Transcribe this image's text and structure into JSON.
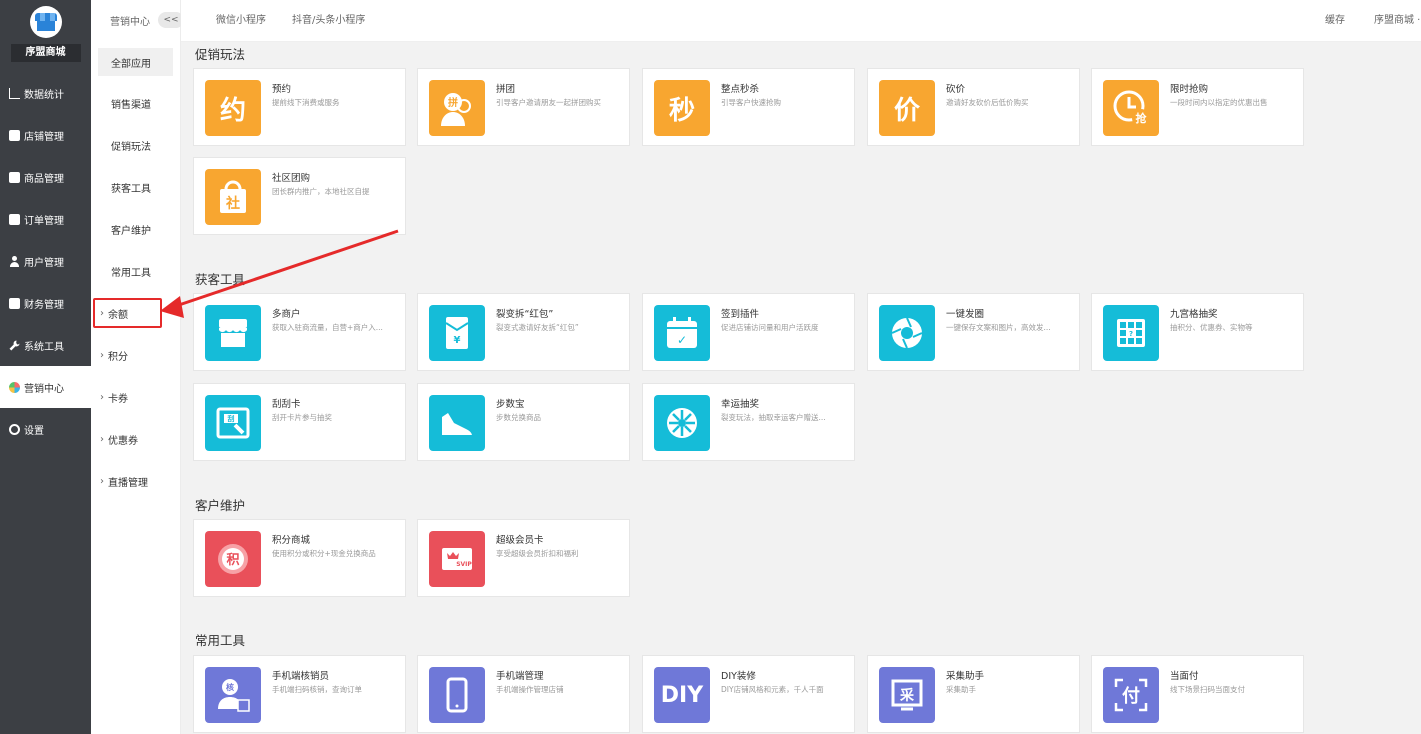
{
  "sidebar": {
    "store_name": "序盟商城",
    "items": [
      {
        "label": "数据统计",
        "icon": "chart-icon"
      },
      {
        "label": "店铺管理",
        "icon": "store-icon"
      },
      {
        "label": "商品管理",
        "icon": "goods-icon"
      },
      {
        "label": "订单管理",
        "icon": "order-icon"
      },
      {
        "label": "用户管理",
        "icon": "user-icon"
      },
      {
        "label": "财务管理",
        "icon": "finance-icon"
      },
      {
        "label": "系统工具",
        "icon": "wrench-icon"
      },
      {
        "label": "营销中心",
        "icon": "pinwheel-icon"
      },
      {
        "label": "设置",
        "icon": "gear-icon"
      }
    ]
  },
  "subside": {
    "title": "营销中心",
    "collapse_label": "<<",
    "items": [
      "全部应用",
      "销售渠道",
      "促销玩法",
      "获客工具",
      "客户维护",
      "常用工具"
    ],
    "expandable": [
      "余额",
      "积分",
      "卡券",
      "优惠券",
      "直播管理"
    ]
  },
  "topbar": {
    "tabs": [
      "微信小程序",
      "抖音/头条小程序"
    ],
    "cache": "缓存",
    "store_menu": "序盟商城 ·"
  },
  "sections": {
    "promo": {
      "title": "促销玩法",
      "cards": [
        {
          "title": "预约",
          "desc": "提前线下消费或服务",
          "glyph": "约"
        },
        {
          "title": "拼团",
          "desc": "引导客户邀请朋友一起拼团购买",
          "glyph": "拼"
        },
        {
          "title": "整点秒杀",
          "desc": "引导客户快速抢购",
          "glyph": "秒"
        },
        {
          "title": "砍价",
          "desc": "邀请好友砍价后低价购买",
          "glyph": "价"
        },
        {
          "title": "限时抢购",
          "desc": "一段时间内以指定的优惠出售",
          "glyph": "抢"
        },
        {
          "title": "社区团购",
          "desc": "团长群内推广，本地社区自提",
          "glyph": "社"
        }
      ]
    },
    "acquire": {
      "title": "获客工具",
      "cards": [
        {
          "title": "多商户",
          "desc": "获取入驻商流量，自营+商户入...",
          "glyph": ""
        },
        {
          "title": "裂变拆“红包”",
          "desc": "裂变式邀请好友拆“红包”",
          "glyph": "¥"
        },
        {
          "title": "签到插件",
          "desc": "促进店铺访问量和用户活跃度",
          "glyph": "✓"
        },
        {
          "title": "一键发圈",
          "desc": "一键保存文案和图片，高效发...",
          "glyph": ""
        },
        {
          "title": "九宫格抽奖",
          "desc": "抽积分、优惠券、实物等",
          "glyph": "?"
        },
        {
          "title": "刮刮卡",
          "desc": "刮开卡片参与抽奖",
          "glyph": "刮"
        },
        {
          "title": "步数宝",
          "desc": "步数兑换商品",
          "glyph": ""
        },
        {
          "title": "幸运抽奖",
          "desc": "裂变玩法，抽取幸运客户赠送...",
          "glyph": ""
        }
      ]
    },
    "retain": {
      "title": "客户维护",
      "cards": [
        {
          "title": "积分商城",
          "desc": "使用积分或积分+现金兑换商品",
          "glyph": "积"
        },
        {
          "title": "超级会员卡",
          "desc": "享受超级会员折扣和福利",
          "glyph": "SVIP"
        }
      ]
    },
    "tools": {
      "title": "常用工具",
      "cards": [
        {
          "title": "手机端核销员",
          "desc": "手机端扫码核销，查询订单",
          "glyph": "核"
        },
        {
          "title": "手机端管理",
          "desc": "手机端操作管理店铺",
          "glyph": ""
        },
        {
          "title": "DIY装修",
          "desc": "DIY店铺风格和元素，千人千面",
          "glyph": "DIY"
        },
        {
          "title": "采集助手",
          "desc": "采集助手",
          "glyph": "采"
        },
        {
          "title": "当面付",
          "desc": "线下场景扫码当面支付",
          "glyph": "付"
        }
      ]
    }
  },
  "colors": {
    "orange": "#f8a630",
    "cyan": "#15bcd8",
    "red": "#e9505a",
    "purple": "#6f78d8",
    "highlight": "#e52a2a"
  }
}
